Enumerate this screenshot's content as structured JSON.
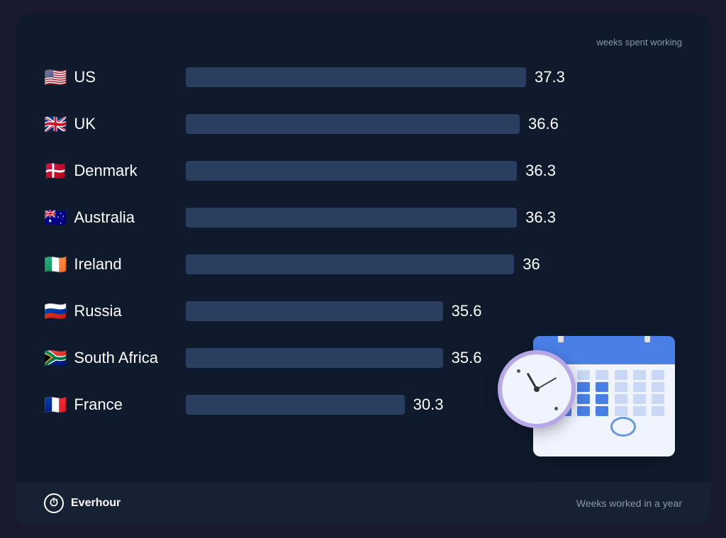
{
  "subtitle": "weeks spent working",
  "maxValue": 37.3,
  "bars": [
    {
      "country": "US",
      "flag": "🇺🇸",
      "value": 37.3
    },
    {
      "country": "UK",
      "flag": "🇬🇧",
      "value": 36.6
    },
    {
      "country": "Denmark",
      "flag": "🇩🇰",
      "value": 36.3
    },
    {
      "country": "Australia",
      "flag": "🇦🇺",
      "value": 36.3
    },
    {
      "country": "Ireland",
      "flag": "🇮🇪",
      "value": 36
    },
    {
      "country": "Russia",
      "flag": "🇷🇺",
      "value": 35.6
    },
    {
      "country": "South Africa",
      "flag": "🇿🇦",
      "value": 35.6
    },
    {
      "country": "France",
      "flag": "🇫🇷",
      "value": 30.3
    }
  ],
  "footer": {
    "brand": "Everhour",
    "note": "Weeks worked in a year"
  }
}
